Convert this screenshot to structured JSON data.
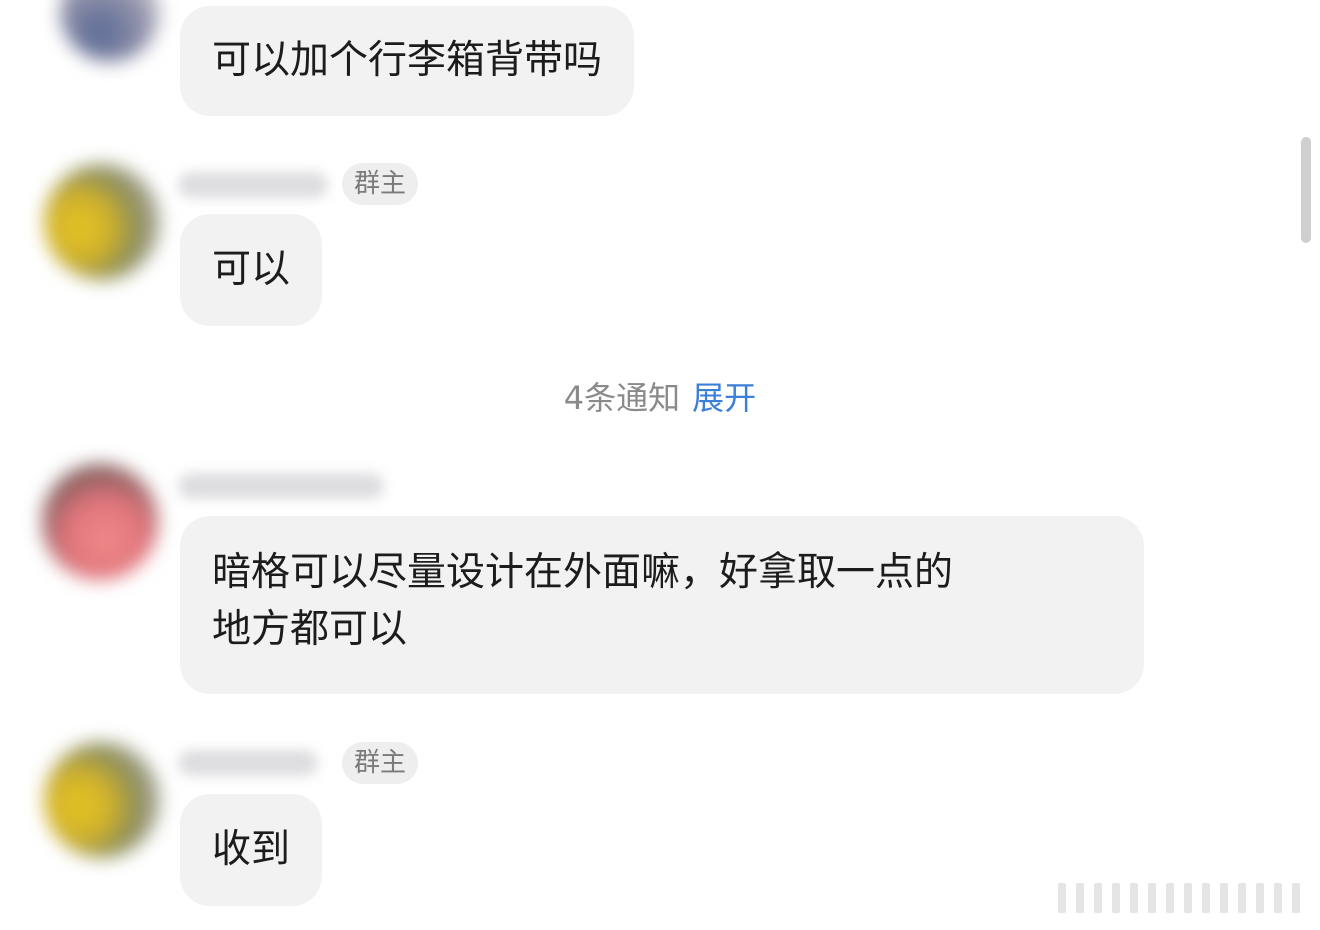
{
  "messages": [
    {
      "text": "可以加个行李箱背带吗"
    },
    {
      "role": "群主",
      "text": "可以"
    },
    {
      "text_line1": "暗格可以尽量设计在外面嘛，好拿取一点的",
      "text_line2": "地方都可以"
    },
    {
      "role": "群主",
      "text": "收到"
    }
  ],
  "notice": {
    "count_text": "4条通知",
    "expand_label": "展开"
  },
  "colors": {
    "bubble": "#f2f2f3",
    "link": "#3b7fd6",
    "muted": "#8a8a8a"
  }
}
